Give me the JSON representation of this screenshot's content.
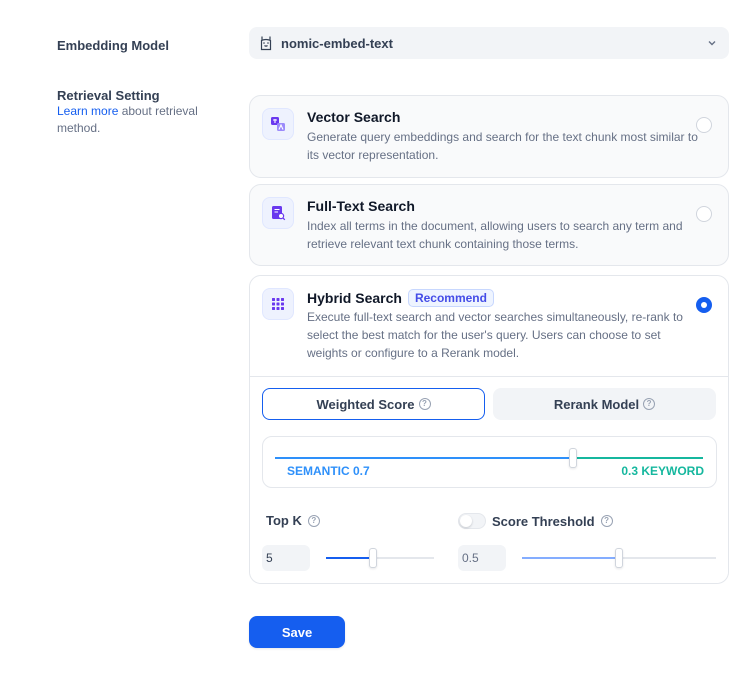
{
  "embedding": {
    "label": "Embedding Model",
    "model_name": "nomic-embed-text"
  },
  "retrieval": {
    "label": "Retrieval Setting",
    "learn_more": "Learn more",
    "description_rest": " about retrieval method.",
    "options": [
      {
        "title": "Vector Search",
        "desc": "Generate query embeddings and search for the text chunk most similar to its vector representation.",
        "selected": false,
        "icon": "vector-search-icon"
      },
      {
        "title": "Full-Text Search",
        "desc": "Index all terms in the document, allowing users to search any term and retrieve relevant text chunk containing those terms.",
        "selected": false,
        "icon": "full-text-search-icon"
      },
      {
        "title": "Hybrid Search",
        "badge": "Recommend",
        "desc": "Execute full-text search and vector searches simultaneously, re-rank to select the best match for the user's query. Users can choose to set weights or configure to a Rerank model.",
        "selected": true,
        "icon": "hybrid-search-icon"
      }
    ],
    "tabs": {
      "weighted": "Weighted Score",
      "rerank": "Rerank Model",
      "active": "weighted"
    },
    "weights": {
      "semantic_label": "SEMANTIC 0.7",
      "keyword_label": "0.3 KEYWORD",
      "semantic": 0.7,
      "keyword": 0.3
    },
    "top_k": {
      "label": "Top K",
      "value": "5",
      "level": 0.43
    },
    "score_threshold": {
      "label": "Score Threshold",
      "value": "0.5",
      "enabled": false,
      "level": 0.5
    }
  },
  "save_label": "Save",
  "colors": {
    "accent": "#155eef",
    "semantic": "#2e90fa",
    "keyword": "#15b79e",
    "icon": "#6938ef"
  }
}
